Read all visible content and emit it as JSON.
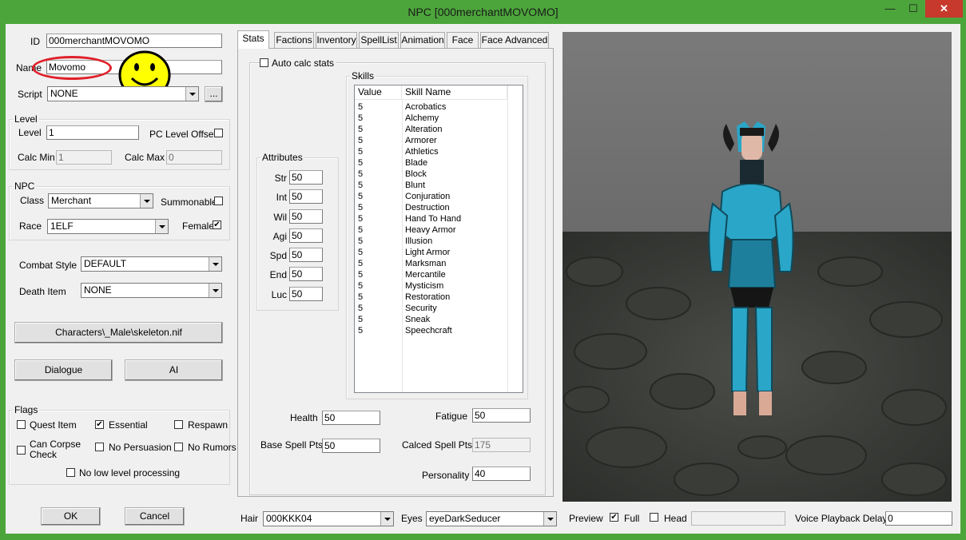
{
  "window": {
    "title": "NPC [000merchantMOVOMO]",
    "minimize_icon": "minimize-icon",
    "maximize_icon": "maximize-icon",
    "close_icon": "close-icon",
    "close_symbol": "✕",
    "minimize_symbol": "—",
    "maximize_symbol": "☐"
  },
  "general": {
    "id_label": "ID",
    "id_value": "000merchantMOVOMO",
    "name_label": "Name",
    "name_value": "Movomo",
    "script_label": "Script",
    "script_value": "NONE",
    "script_browse": "..."
  },
  "level_group": {
    "title": "Level",
    "level_label": "Level",
    "level_value": "1",
    "pc_offset_label": "PC Level Offset",
    "calc_min_label": "Calc Min",
    "calc_min_value": "1",
    "calc_max_label": "Calc Max",
    "calc_max_value": "0"
  },
  "npc_group": {
    "title": "NPC",
    "class_label": "Class",
    "class_value": "Merchant",
    "summonable_label": "Summonable",
    "race_label": "Race",
    "race_value": "1ELF",
    "female_label": "Female",
    "female_checked": true
  },
  "combat_style": {
    "label": "Combat Style",
    "value": "DEFAULT"
  },
  "death_item": {
    "label": "Death Item",
    "value": "NONE"
  },
  "skeleton_button": "Characters\\_Male\\skeleton.nif",
  "dialogue_button": "Dialogue",
  "ai_button": "AI",
  "flags": {
    "title": "Flags",
    "quest_item": "Quest Item",
    "essential": "Essential",
    "respawn": "Respawn",
    "can_corpse_check": "Can Corpse Check",
    "can_corpse_line1": "Can Corpse",
    "can_corpse_line2": "Check",
    "no_persuasion": "No Persuasion",
    "no_rumors": "No Rumors",
    "no_low_level": "No low level processing",
    "check_mark": "✔"
  },
  "ok_button": "OK",
  "cancel_button": "Cancel",
  "tabs": [
    {
      "label": "Stats"
    },
    {
      "label": "Factions"
    },
    {
      "label": "Inventory"
    },
    {
      "label": "SpellList"
    },
    {
      "label": "Animation"
    },
    {
      "label": "Face"
    },
    {
      "label": "Face Advanced"
    }
  ],
  "stats": {
    "auto_calc_label": "Auto calc stats",
    "attributes_title": "Attributes",
    "attributes": [
      {
        "label": "Str",
        "value": "50"
      },
      {
        "label": "Int",
        "value": "50"
      },
      {
        "label": "Wil",
        "value": "50"
      },
      {
        "label": "Agi",
        "value": "50"
      },
      {
        "label": "Spd",
        "value": "50"
      },
      {
        "label": "End",
        "value": "50"
      },
      {
        "label": "Luc",
        "value": "50"
      }
    ],
    "skills_title": "Skills",
    "skills_header_value": "Value",
    "skills_header_name": "Skill Name",
    "skills": [
      {
        "value": "5",
        "name": "Acrobatics"
      },
      {
        "value": "5",
        "name": "Alchemy"
      },
      {
        "value": "5",
        "name": "Alteration"
      },
      {
        "value": "5",
        "name": "Armorer"
      },
      {
        "value": "5",
        "name": "Athletics"
      },
      {
        "value": "5",
        "name": "Blade"
      },
      {
        "value": "5",
        "name": "Block"
      },
      {
        "value": "5",
        "name": "Blunt"
      },
      {
        "value": "5",
        "name": "Conjuration"
      },
      {
        "value": "5",
        "name": "Destruction"
      },
      {
        "value": "5",
        "name": "Hand To Hand"
      },
      {
        "value": "5",
        "name": "Heavy Armor"
      },
      {
        "value": "5",
        "name": "Illusion"
      },
      {
        "value": "5",
        "name": "Light Armor"
      },
      {
        "value": "5",
        "name": "Marksman"
      },
      {
        "value": "5",
        "name": "Mercantile"
      },
      {
        "value": "5",
        "name": "Mysticism"
      },
      {
        "value": "5",
        "name": "Restoration"
      },
      {
        "value": "5",
        "name": "Security"
      },
      {
        "value": "5",
        "name": "Sneak"
      },
      {
        "value": "5",
        "name": "Speechcraft"
      }
    ],
    "health_label": "Health",
    "health_value": "50",
    "fatigue_label": "Fatigue",
    "fatigue_value": "50",
    "base_spell_label": "Base Spell Pts",
    "base_spell_value": "50",
    "calced_spell_label": "Calced Spell Pts",
    "calced_spell_value": "175",
    "personality_label": "Personality",
    "personality_value": "40"
  },
  "bottom": {
    "hair_label": "Hair",
    "hair_value": "000KKK04",
    "eyes_label": "Eyes",
    "eyes_value": "eyeDarkSeducer",
    "preview_label": "Preview",
    "full_label": "Full",
    "full_checked": true,
    "head_label": "Head",
    "head_checked": false,
    "voice_delay_label": "Voice Playback Delay",
    "voice_delay_value": "0"
  },
  "colors": {
    "titlebar": "#4ca53b",
    "close_button": "#c7392c",
    "annotation_circle": "#e0202a",
    "smiley": "#ffff00",
    "character_accent": "#2aa6c8"
  }
}
